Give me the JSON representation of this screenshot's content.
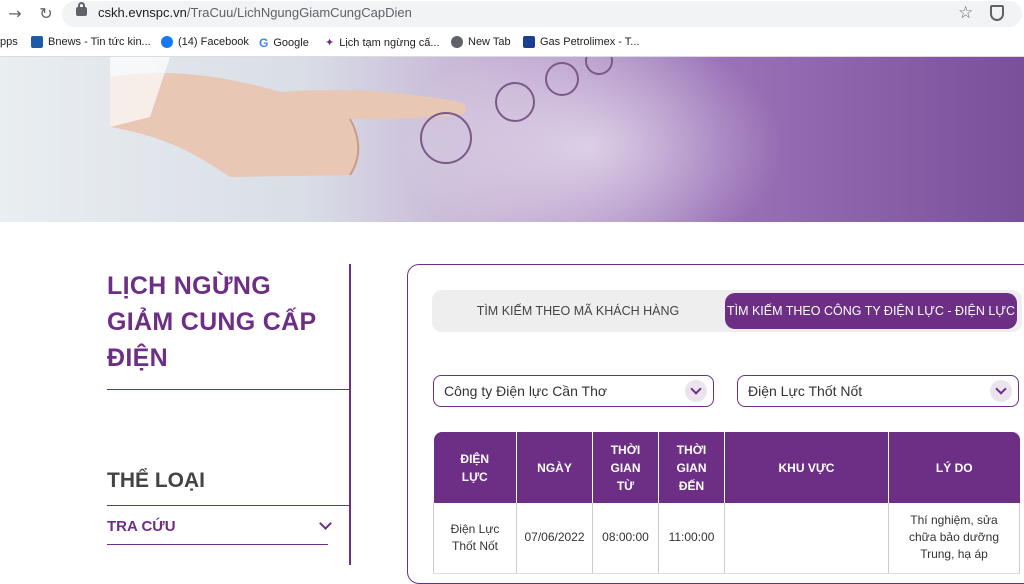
{
  "browser": {
    "url_host": "cskh.evnspc.vn",
    "url_path": "/TraCuu/LichNgungGiamCungCapDien",
    "bookmarks": [
      {
        "label": "pps",
        "icon": "apps-icon"
      },
      {
        "label": "Bnews - Tin tức kin...",
        "icon": "bnews-icon"
      },
      {
        "label": "(14) Facebook",
        "icon": "facebook-icon"
      },
      {
        "label": "Google",
        "icon": "google-icon"
      },
      {
        "label": "Lịch tạm ngừng cấ...",
        "icon": "evn-icon"
      },
      {
        "label": "New Tab",
        "icon": "globe-icon"
      },
      {
        "label": "Gas Petrolimex - T...",
        "icon": "petrolimex-icon"
      }
    ]
  },
  "sidebar": {
    "title_line1": "LỊCH NGỪNG",
    "title_line2": "GIẢM CUNG CẤP",
    "title_line3": "ĐIỆN",
    "section_title": "THỂ LOẠI",
    "menu_item": "TRA CỨU"
  },
  "search": {
    "tab_customer": "TÌM KIẾM THEO MÃ KHÁCH HÀNG",
    "tab_company": "TÌM KIẾM THEO CÔNG TY ĐIỆN LỰC - ĐIỆN LỰC",
    "company_select": "Công ty Điện lực Cần Thơ",
    "branch_select": "Điện Lực Thốt Nốt"
  },
  "table": {
    "headers": {
      "col1_l1": "ĐIỆN",
      "col1_l2": "LỰC",
      "col2": "NGÀY",
      "col3_l1": "THỜI",
      "col3_l2": "GIAN",
      "col3_l3": "TỪ",
      "col4_l1": "THỜI",
      "col4_l2": "GIAN",
      "col4_l3": "ĐẾN",
      "col5": "KHU VỰC",
      "col6": "LÝ DO"
    },
    "row1": {
      "unit_l1": "Điện Lực",
      "unit_l2": "Thốt Nốt",
      "date": "07/06/2022",
      "from": "08:00:00",
      "to": "11:00:00",
      "area": "",
      "reason_l1": "Thí nghiệm, sửa",
      "reason_l2": "chữa bảo dưỡng",
      "reason_l3": "Trung, hạ áp"
    }
  },
  "colors": {
    "brand_purple": "#6d2f86"
  }
}
